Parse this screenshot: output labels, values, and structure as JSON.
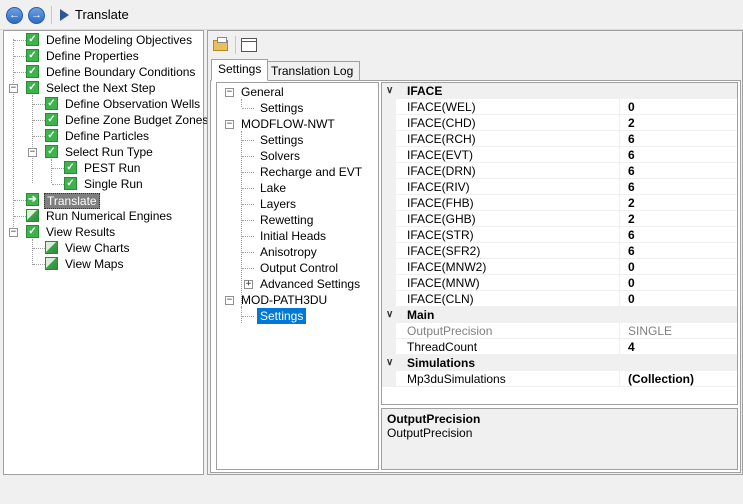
{
  "window": {
    "title": "Translate"
  },
  "nav": {
    "back_glyph": "←",
    "forward_glyph": "→"
  },
  "workflow": [
    {
      "label": "Define Modeling Objectives",
      "status": "check"
    },
    {
      "label": "Define Properties",
      "status": "check"
    },
    {
      "label": "Define Boundary Conditions",
      "status": "check"
    },
    {
      "label": "Select the Next Step",
      "status": "check"
    },
    {
      "label": "Define Observation Wells",
      "status": "check"
    },
    {
      "label": "Define Zone Budget Zones",
      "status": "check"
    },
    {
      "label": "Define Particles",
      "status": "check"
    },
    {
      "label": "Select Run Type",
      "status": "check"
    },
    {
      "label": "PEST Run",
      "status": "check"
    },
    {
      "label": "Single Run",
      "status": "check"
    },
    {
      "label": "Translate",
      "status": "arrow"
    },
    {
      "label": "Run Numerical Engines",
      "status": "chart"
    },
    {
      "label": "View Results",
      "status": "check"
    },
    {
      "label": "View Charts",
      "status": "chart"
    },
    {
      "label": "View Maps",
      "status": "chart"
    }
  ],
  "tabs": [
    {
      "label": "Settings"
    },
    {
      "label": "Translation Log"
    }
  ],
  "settings_tree": [
    {
      "label": "General"
    },
    {
      "label": "Settings"
    },
    {
      "label": "MODFLOW-NWT"
    },
    {
      "label": "Settings"
    },
    {
      "label": "Solvers"
    },
    {
      "label": "Recharge and EVT"
    },
    {
      "label": "Lake"
    },
    {
      "label": "Layers"
    },
    {
      "label": "Rewetting"
    },
    {
      "label": "Initial Heads"
    },
    {
      "label": "Anisotropy"
    },
    {
      "label": "Output Control"
    },
    {
      "label": "Advanced Settings"
    },
    {
      "label": "MOD-PATH3DU"
    },
    {
      "label": "Settings"
    }
  ],
  "tree_glyphs": {
    "collapse": "−",
    "expand": "+",
    "check": "✓",
    "arrow": "➔"
  },
  "grid_glyphs": {
    "collapse": "∨"
  },
  "property_grid": {
    "categories": [
      {
        "name": "IFACE",
        "rows": [
          {
            "name": "IFACE(WEL)",
            "value": "0"
          },
          {
            "name": "IFACE(CHD)",
            "value": "2"
          },
          {
            "name": "IFACE(RCH)",
            "value": "6"
          },
          {
            "name": "IFACE(EVT)",
            "value": "6"
          },
          {
            "name": "IFACE(DRN)",
            "value": "6"
          },
          {
            "name": "IFACE(RIV)",
            "value": "6"
          },
          {
            "name": "IFACE(FHB)",
            "value": "2"
          },
          {
            "name": "IFACE(GHB)",
            "value": "2"
          },
          {
            "name": "IFACE(STR)",
            "value": "6"
          },
          {
            "name": "IFACE(SFR2)",
            "value": "6"
          },
          {
            "name": "IFACE(MNW2)",
            "value": "0"
          },
          {
            "name": "IFACE(MNW)",
            "value": "0"
          },
          {
            "name": "IFACE(CLN)",
            "value": "0"
          }
        ]
      },
      {
        "name": "Main",
        "rows": [
          {
            "name": "OutputPrecision",
            "value": "SINGLE"
          },
          {
            "name": "ThreadCount",
            "value": "4"
          }
        ]
      },
      {
        "name": "Simulations",
        "rows": [
          {
            "name": "Mp3duSimulations",
            "value": "(Collection)"
          }
        ]
      }
    ]
  },
  "description": {
    "title": "OutputPrecision",
    "text": "OutputPrecision"
  }
}
